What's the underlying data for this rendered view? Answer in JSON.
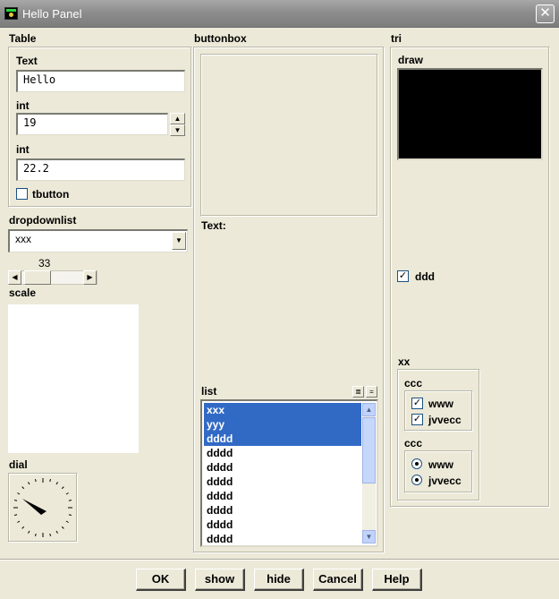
{
  "window": {
    "title": "Hello Panel"
  },
  "table": {
    "label": "Table",
    "text_label": "Text",
    "text_value": "Hello",
    "int1_label": "int",
    "int1_value": "19",
    "int2_label": "int",
    "int2_value": "22.2",
    "tbutton_label": "tbutton",
    "tbutton_checked": false
  },
  "dropdown": {
    "label": "dropdownlist",
    "selected": "xxx"
  },
  "slider": {
    "value": "33",
    "fraction": 0.33
  },
  "scale": {
    "label": "scale"
  },
  "dial": {
    "label": "dial"
  },
  "buttonbox": {
    "label": "buttonbox",
    "text_label": "Text:"
  },
  "list": {
    "label": "list",
    "items": [
      {
        "text": "xxx",
        "selected": true
      },
      {
        "text": "yyy",
        "selected": true
      },
      {
        "text": "dddd",
        "selected": true
      },
      {
        "text": "dddd",
        "selected": false
      },
      {
        "text": "dddd",
        "selected": false
      },
      {
        "text": "dddd",
        "selected": false
      },
      {
        "text": "dddd",
        "selected": false
      },
      {
        "text": "dddd",
        "selected": false
      },
      {
        "text": "dddd",
        "selected": false
      },
      {
        "text": "dddd",
        "selected": false
      }
    ]
  },
  "tri": {
    "label": "tri",
    "draw_label": "draw",
    "draw_bg": "#000000",
    "ddd_label": "ddd",
    "ddd_checked": true,
    "xx_label": "xx",
    "ccc1": {
      "label": "ccc",
      "items": [
        {
          "text": "www",
          "checked": true
        },
        {
          "text": "jvvecc",
          "checked": true
        }
      ]
    },
    "ccc2": {
      "label": "ccc",
      "items": [
        {
          "text": "www",
          "checked": true
        },
        {
          "text": "jvvecc",
          "checked": true
        }
      ]
    }
  },
  "buttons": {
    "ok": "OK",
    "show": "show",
    "hide": "hide",
    "cancel": "Cancel",
    "help": "Help"
  },
  "colors": {
    "panel_bg": "#ece9d8",
    "selection": "#316ac5",
    "titlebar": "#8d8d8d"
  }
}
